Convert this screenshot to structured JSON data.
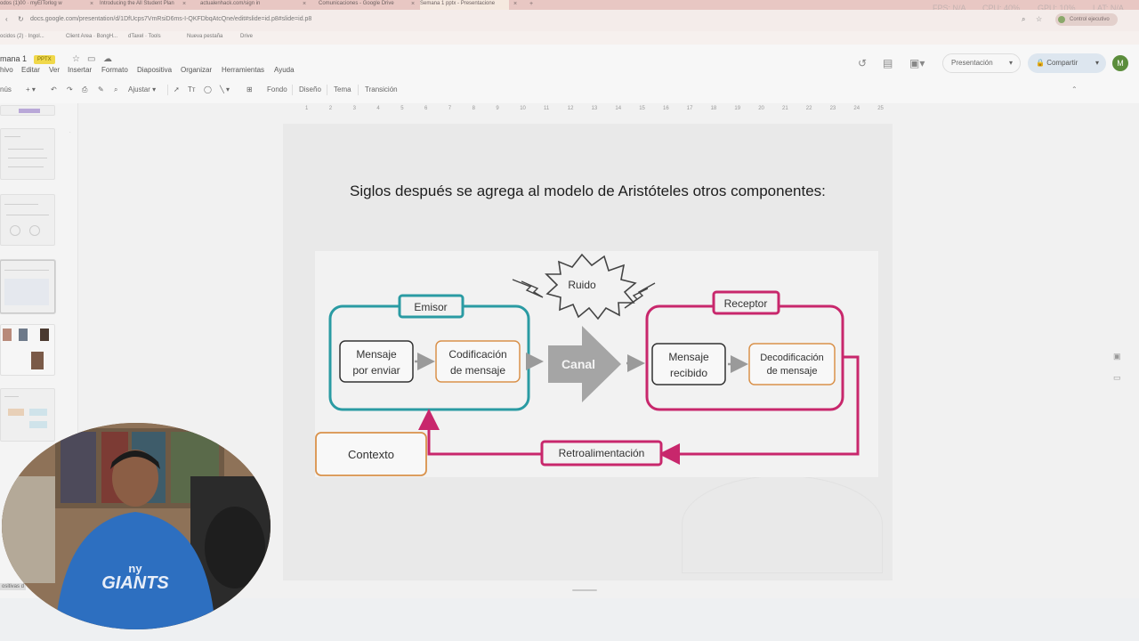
{
  "browser": {
    "tabs": [
      {
        "label": "odos (1)00 · myElTorlog w",
        "active": false
      },
      {
        "label": "Introducing the All Student Plan",
        "active": false
      },
      {
        "label": "actualenhack.com/sign in",
        "active": false
      },
      {
        "label": "Comunicaciones - Google Drive",
        "active": false
      },
      {
        "label": "Semana 1 pptx - Presentacione",
        "active": true
      }
    ],
    "stats": {
      "fps": "FPS: N/A",
      "cpu": "CPU: 40%",
      "gpu": "GPU: 10%",
      "lat": "LAT: N/A"
    },
    "url": "docs.google.com/presentation/d/1DfUcps7VmRsiD6ms-I-QKFDbqAtcQne/edit#slide=id.p8#slide=id.p8",
    "profile_label": "Control ejecutivo",
    "bookmarks": [
      "ocidos (2) · Ingol...",
      "Client Area · BongH...",
      "dTaxel · Tools",
      "Nueva pestaña",
      "Drive"
    ]
  },
  "doc": {
    "title": "mana 1",
    "badge": "PPTX",
    "menu": [
      "hivo",
      "Editar",
      "Ver",
      "Insertar",
      "Formato",
      "Diapositiva",
      "Organizar",
      "Herramientas",
      "Ayuda"
    ],
    "toolbar": {
      "zoom": "Ajustar",
      "fondo": "Fondo",
      "diseno": "Diseño",
      "tema": "Tema",
      "transicion": "Transición"
    },
    "present_label": "Presentación",
    "share_label": "Compartir",
    "avatar_initial": "M",
    "menu_short": "nús"
  },
  "ruler": [
    "1",
    "2",
    "3",
    "4",
    "5",
    "6",
    "7",
    "8",
    "9",
    "10",
    "11",
    "12",
    "13",
    "14",
    "15",
    "16",
    "17",
    "18",
    "19",
    "20",
    "21",
    "22",
    "23",
    "24",
    "25"
  ],
  "filmstrip": {
    "bottom_label": "ositivas d"
  },
  "slide": {
    "text": "Siglos después se agrega al modelo de Aristóteles otros componentes:",
    "diagram": {
      "noise": "Ruido",
      "sender": "Emisor",
      "sender_msg_1": "Mensaje",
      "sender_msg_2": "por enviar",
      "encoding_1": "Codificación",
      "encoding_2": "de mensaje",
      "channel": "Canal",
      "receiver": "Receptor",
      "received_1": "Mensaje",
      "received_2": "recibido",
      "decoding_1": "Decodificación",
      "decoding_2": "de mensaje",
      "context": "Contexto",
      "feedback": "Retroalimentación"
    },
    "colors": {
      "teal": "#2a9ba3",
      "magenta": "#c8276c",
      "orange": "#d9914a",
      "gray_arrow": "#9a9a9a"
    }
  }
}
